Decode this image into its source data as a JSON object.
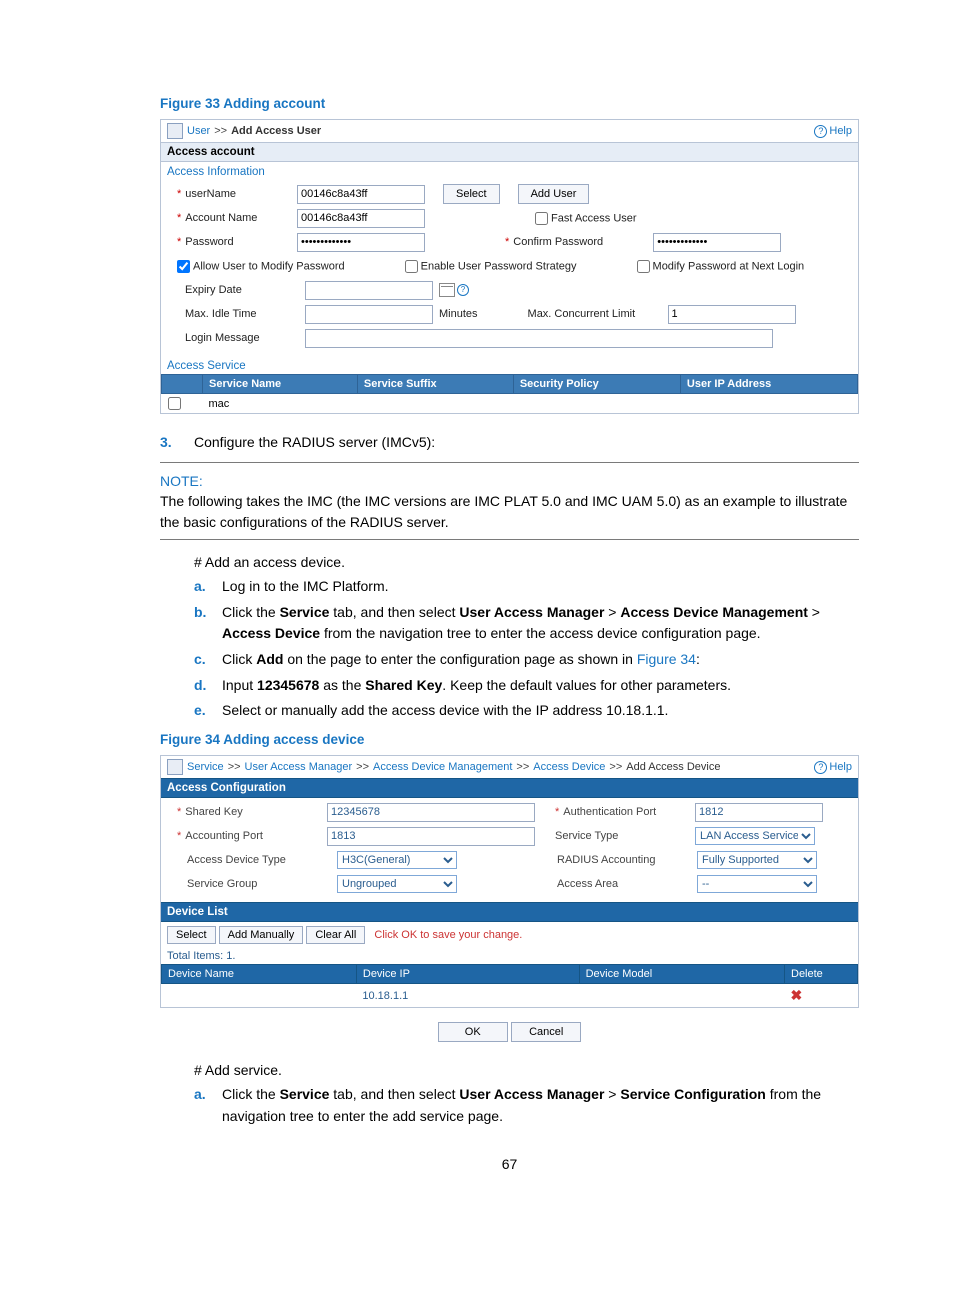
{
  "page_number": "67",
  "fig33": {
    "caption": "Figure 33 Adding account",
    "breadcrumb": {
      "root": "User",
      "sep": ">>",
      "current": "Add Access User"
    },
    "help": "Help",
    "section": "Access account",
    "sub": "Access Information",
    "labels": {
      "userName": "userName",
      "accountName": "Account Name",
      "password": "Password",
      "confirmPassword": "Confirm Password",
      "fastAccess": "Fast Access User",
      "allowModify": "Allow User to Modify Password",
      "enableStrategy": "Enable User Password Strategy",
      "modifyNext": "Modify Password at Next Login",
      "expiry": "Expiry Date",
      "maxIdle": "Max. Idle Time",
      "minutes": "Minutes",
      "maxConcurrent": "Max. Concurrent Limit",
      "loginMsg": "Login Message"
    },
    "values": {
      "userName": "00146c8a43ff",
      "accountName": "00146c8a43ff",
      "password": "•••••••••••••",
      "confirmPassword": "•••••••••••••",
      "concurrent": "1"
    },
    "buttons": {
      "select": "Select",
      "addUser": "Add User"
    },
    "serviceHead": "Access Service",
    "cols": {
      "name": "Service Name",
      "suffix": "Service Suffix",
      "policy": "Security Policy",
      "ip": "User IP Address"
    },
    "row1": "mac"
  },
  "step3": {
    "num": "3.",
    "text": "Configure the RADIUS server (IMCv5):"
  },
  "note": {
    "head": "NOTE:",
    "body": "The following takes the IMC (the IMC versions are IMC PLAT 5.0 and IMC UAM 5.0) as an example to illustrate the basic configurations of the RADIUS server."
  },
  "addDevice": {
    "hash": "# Add an access device.",
    "a": "Log in to the IMC Platform.",
    "b_pre": "Click the ",
    "b_service": "Service",
    "b_mid1": " tab, and then select ",
    "b_uam": "User Access Manager",
    "b_gt": " > ",
    "b_adm": "Access Device Management",
    "b_mid2": " > ",
    "b_ad": "Access Device",
    "b_post": " from the navigation tree to enter the access device configuration page.",
    "c_pre": "Click ",
    "c_add": "Add",
    "c_mid": " on the page to enter the configuration page as shown in ",
    "c_link": "Figure 34",
    "c_post": ":",
    "d_pre": "Input ",
    "d_key": "12345678",
    "d_mid": " as the ",
    "d_sk": "Shared Key",
    "d_post": ". Keep the default values for other parameters.",
    "e": "Select or manually add the access device with the IP address 10.18.1.1."
  },
  "fig34": {
    "caption": "Figure 34 Adding access device",
    "breadcrumb": {
      "p1": "Service",
      "p2": "User Access Manager",
      "p3": "Access Device Management",
      "p4": "Access Device",
      "cur": "Add Access Device",
      "sep": ">>"
    },
    "help": "Help",
    "section": "Access Configuration",
    "labels": {
      "sharedKey": "Shared Key",
      "authPort": "Authentication Port",
      "acctPort": "Accounting Port",
      "serviceType": "Service Type",
      "deviceType": "Access Device Type",
      "radiusAcct": "RADIUS Accounting",
      "serviceGroup": "Service Group",
      "accessArea": "Access Area"
    },
    "values": {
      "sharedKey": "12345678",
      "authPort": "1812",
      "acctPort": "1813",
      "serviceType": "LAN Access Service",
      "deviceType": "H3C(General)",
      "radiusAcct": "Fully Supported",
      "serviceGroup": "Ungrouped",
      "accessArea": "--"
    },
    "deviceList": {
      "head": "Device List",
      "select": "Select",
      "addManually": "Add Manually",
      "clearAll": "Clear All",
      "hint": "Click OK to save your change.",
      "total": "Total Items: 1.",
      "cols": {
        "name": "Device Name",
        "ip": "Device IP",
        "model": "Device Model",
        "delete": "Delete"
      },
      "ip": "10.18.1.1"
    },
    "ok": "OK",
    "cancel": "Cancel"
  },
  "addService": {
    "hash": "# Add service.",
    "a_pre": "Click the ",
    "a_service": "Service",
    "a_mid": " tab, and then select ",
    "a_uam": "User Access Manager",
    "a_gt": " > ",
    "a_sc": "Service Configuration",
    "a_post": " from the navigation tree to enter the add service page."
  }
}
